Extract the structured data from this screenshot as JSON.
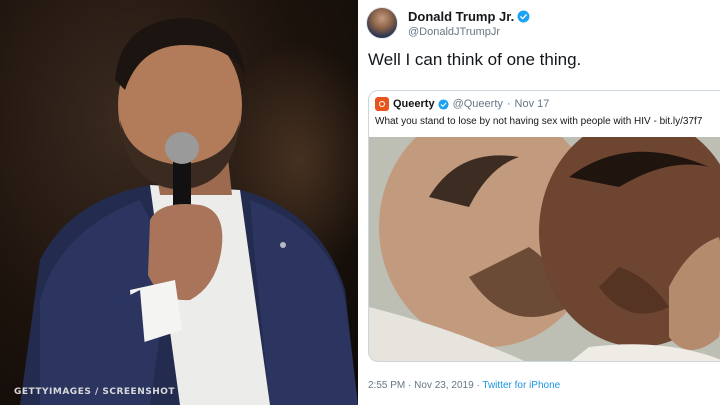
{
  "left_photo": {
    "credit": "GETTYIMAGES / SCREENSHOT"
  },
  "tweet": {
    "display_name": "Donald Trump Jr.",
    "handle": "@DonaldJTrumpJr",
    "text": "Well I can think of one thing.",
    "meta": {
      "time": "2:55 PM",
      "separator": "·",
      "date": "Nov 23, 2019",
      "source": "Twitter for iPhone"
    }
  },
  "quoted_tweet": {
    "display_name": "Queerty",
    "handle": "@Queerty",
    "separator": "·",
    "date": "Nov 17",
    "text": "What you stand to lose by not having sex with people with HIV - bit.ly/37f7"
  },
  "colors": {
    "verified_blue": "#1da1f2",
    "link_blue": "#1b95e0",
    "queerty_orange": "#e8541e"
  }
}
